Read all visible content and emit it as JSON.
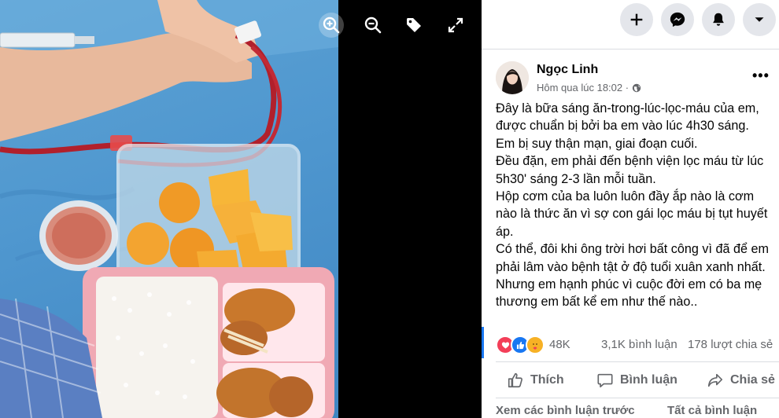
{
  "viewer": {
    "controls": [
      {
        "name": "zoom-in-icon"
      },
      {
        "name": "zoom-out-icon"
      },
      {
        "name": "tag-icon"
      },
      {
        "name": "fullscreen-icon"
      }
    ]
  },
  "topbar": {
    "buttons": [
      {
        "name": "create-icon"
      },
      {
        "name": "messenger-icon"
      },
      {
        "name": "notifications-icon"
      },
      {
        "name": "account-menu-icon"
      }
    ]
  },
  "post": {
    "author": "Ngọc Linh",
    "timestamp": "Hôm qua lúc 18:02 ·",
    "privacy_icon": "globe-icon",
    "body_lines": [
      "Đây là bữa sáng ăn-trong-lúc-lọc-máu của em,",
      "được chuẩn bị bởi ba em vào lúc 4h30 sáng.",
      "Em bị suy thận mạn, giai đoạn cuối.",
      "Đều đặn, em phải đến bệnh viện lọc máu từ lúc",
      "5h30' sáng 2-3 lần mỗi tuần.",
      "Hộp cơm của ba luôn luôn đầy ắp nào là cơm",
      "nào là thức ăn vì sợ con gái lọc máu bị tụt huyết",
      "áp.",
      "Có thể, đôi khi ông trời hơi bất công vì đã để em",
      "phải lâm vào bệnh tật ở độ tuổi xuân xanh nhất.",
      "Nhưng em hạnh phúc vì cuộc đời em có ba mẹ",
      "thương em bất kể em như thế nào.."
    ],
    "reactions": [
      "love-icon",
      "like-icon",
      "care-icon"
    ],
    "reaction_count": "48K",
    "comment_count": "3,1K bình luận",
    "share_count": "178 lượt chia sẻ",
    "actions": {
      "like": "Thích",
      "comment": "Bình luận",
      "share": "Chia sẻ"
    },
    "more_comments": "Xem các bình luận trước",
    "comment_filter": "Tất cả bình luận"
  }
}
